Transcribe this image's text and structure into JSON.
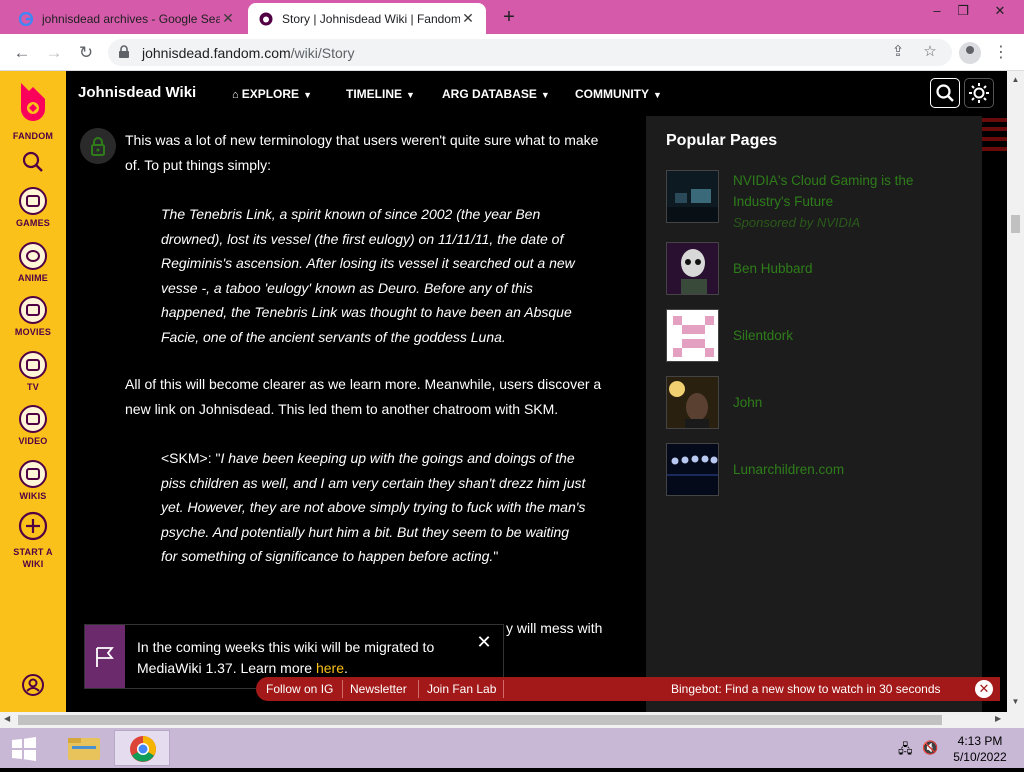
{
  "browser": {
    "tabs": [
      {
        "title": "johnisdead archives - Google Sea",
        "active": false,
        "favicon": "google-icon"
      },
      {
        "title": "Story | Johnisdead Wiki | Fandom",
        "active": true,
        "favicon": "fandom-icon"
      }
    ],
    "url_host": "johnisdead.fandom.com",
    "url_path": "/wiki/Story",
    "new_tab": "+",
    "window_controls": [
      "–",
      "❐",
      "✕"
    ]
  },
  "rail": {
    "fandom": "FANDOM",
    "items": [
      "GAMES",
      "ANIME",
      "MOVIES",
      "TV",
      "VIDEO",
      "WIKIS"
    ],
    "start_a_wiki": "START A WIKI"
  },
  "header": {
    "wiki_name": "Johnisdead Wiki",
    "nav": [
      "EXPLORE",
      "TIMELINE",
      "ARG DATABASE",
      "COMMUNITY"
    ]
  },
  "article": {
    "para1": "This was a lot of new terminology that users weren't quite sure what to make of. To put things simply:",
    "quote1": "The Tenebris Link, a spirit known of since 2002 (the year Ben drowned), lost its vessel (the first eulogy) on 11/11/11, the date of Regiminis's ascension. After losing its vessel it searched out a new vesse -, a taboo 'eulogy' known as Deuro. Before any of this happened, the Tenebris Link was thought to have been an Absque Facie, one of the ancient servants of the goddess Luna.",
    "para2": "All of this will become clearer as we learn more. Meanwhile, users discover a new link on Johnisdead. This led them to another chatroom with SKM.",
    "quote2_speaker": "<SKM>: \"",
    "quote2": "I have been keeping up with the goings and doings of the piss children as well, and I am very certain they shan't drezz him just yet. However, they are not above simply trying to fuck with the man's psyche. And potentially hurt him a bit. But they seem to be waiting for something of significance to happen before acting.",
    "quote2_end": "\"",
    "para3_fragment": "y will mess with"
  },
  "popular_pages": {
    "title": "Popular Pages",
    "items": [
      {
        "label": "NVIDIA's Cloud Gaming is the Industry's Future",
        "sponsor": "Sponsored by NVIDIA"
      },
      {
        "label": "Ben Hubbard"
      },
      {
        "label": "Silentdork"
      },
      {
        "label": "John"
      },
      {
        "label": "Lunarchildren.com"
      }
    ]
  },
  "notice": {
    "text": "In the coming weeks this wiki will be migrated to MediaWiki 1.37. Learn more ",
    "link": "here",
    "tail": "."
  },
  "global_bar": {
    "links": [
      "Follow on IG",
      "Newsletter",
      "Join Fan Lab"
    ],
    "bingebot": "Bingebot: Find a new show to watch in 30 seconds"
  },
  "taskbar": {
    "time": "4:13 PM",
    "date": "5/10/2022"
  },
  "colors": {
    "tab_strip": "#d55aa9",
    "fandom_rail": "#f9c11a",
    "popular_link": "#2e7d1a",
    "global_bar": "#a31818"
  }
}
